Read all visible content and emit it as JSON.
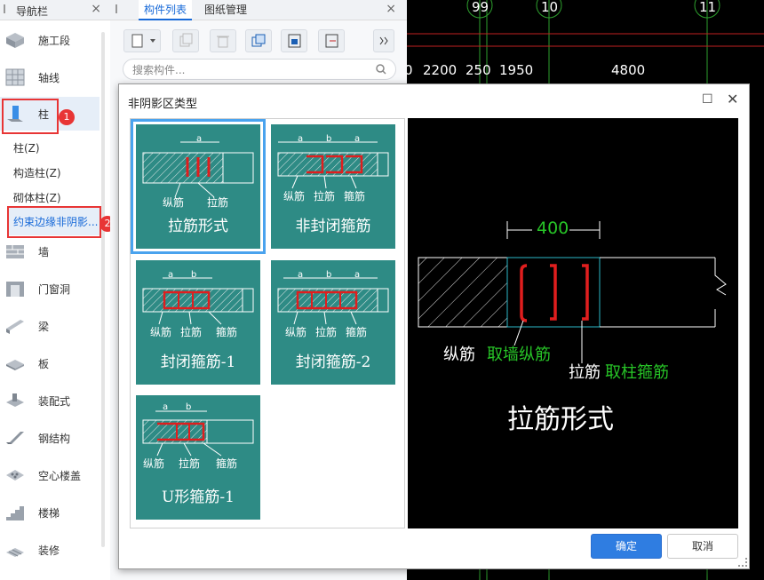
{
  "nav": {
    "title": "导航栏",
    "items": [
      {
        "label": "施工段",
        "icon": "construction-section-icon"
      },
      {
        "label": "轴线",
        "icon": "axis-grid-icon"
      },
      {
        "label": "柱",
        "icon": "column-icon"
      },
      {
        "label": "墙",
        "icon": "wall-icon"
      },
      {
        "label": "门窗洞",
        "icon": "door-window-icon"
      },
      {
        "label": "梁",
        "icon": "beam-icon"
      },
      {
        "label": "板",
        "icon": "slab-icon"
      },
      {
        "label": "装配式",
        "icon": "prefab-icon"
      },
      {
        "label": "钢结构",
        "icon": "steel-structure-icon"
      },
      {
        "label": "空心楼盖",
        "icon": "hollow-floor-icon"
      },
      {
        "label": "楼梯",
        "icon": "stairs-icon"
      },
      {
        "label": "装修",
        "icon": "decoration-icon"
      }
    ],
    "sub_items": [
      "柱(Z)",
      "构造柱(Z)",
      "砌体柱(Z)",
      "约束边缘非阴影..."
    ],
    "badges": [
      "1",
      "2"
    ]
  },
  "panel": {
    "tabs": [
      "构件列表",
      "图纸管理"
    ],
    "search_placeholder": "搜索构件..."
  },
  "cad": {
    "axis_numbers": [
      "99",
      "10",
      "11"
    ],
    "dimensions": [
      "0",
      "2200",
      "250",
      "1950",
      "4800"
    ]
  },
  "dialog": {
    "title": "非阴影区类型",
    "cards": [
      {
        "caption": "拉筋形式",
        "labels": [
          "a",
          "纵筋",
          "拉筋"
        ]
      },
      {
        "caption": "非封闭箍筋",
        "labels": [
          "a",
          "b",
          "a",
          "纵筋",
          "拉筋",
          "箍筋"
        ]
      },
      {
        "caption": "封闭箍筋-1",
        "labels": [
          "a",
          "b",
          "纵筋",
          "拉筋",
          "箍筋"
        ]
      },
      {
        "caption": "封闭箍筋-2",
        "labels": [
          "a",
          "b",
          "a",
          "纵筋",
          "拉筋",
          "箍筋"
        ]
      },
      {
        "caption": "U形箍筋-1",
        "labels": [
          "a",
          "b",
          "纵筋",
          "拉筋",
          "箍筋"
        ]
      }
    ],
    "preview": {
      "dimension": "400",
      "label1": "纵筋",
      "label1_note": "取墙纵筋",
      "label2": "拉筋",
      "label2_note": "取柱箍筋",
      "caption": "拉筋形式"
    },
    "ok_label": "确定",
    "cancel_label": "取消"
  },
  "colors": {
    "accent": "#2f7de1",
    "card_bg": "#2e8b85",
    "rebar_red": "#e01e1e",
    "preview_green": "#27c427",
    "marker_red": "#e83535"
  }
}
